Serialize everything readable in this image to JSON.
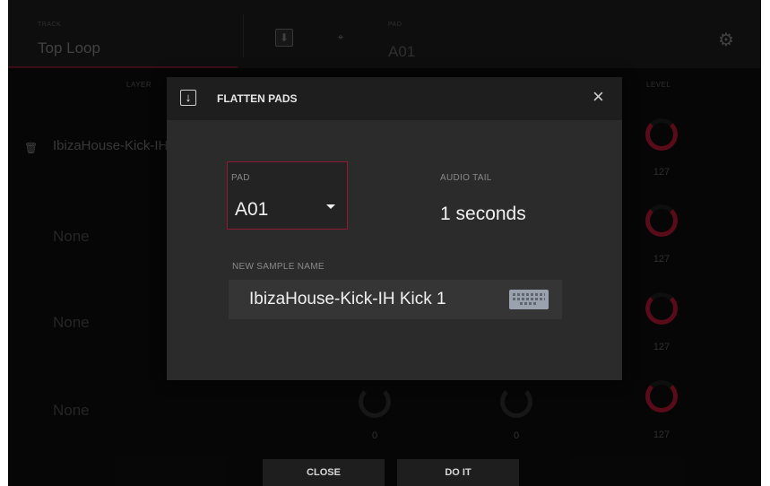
{
  "header": {
    "track_label": "TRACK",
    "track_name": "Top Loop",
    "pad_label": "PAD",
    "pad_name": "A01"
  },
  "columns": {
    "layer": "LAYER",
    "level": "LEVEL"
  },
  "layers": [
    {
      "name": "IbizaHouse-Kick-IH",
      "level": "127"
    },
    {
      "name": "None",
      "level": "127"
    },
    {
      "name": "None",
      "level": "127"
    },
    {
      "name": "None",
      "level": "127"
    }
  ],
  "row4_knobs": [
    "0",
    "0"
  ],
  "bottom_buttons": {
    "close": "CLOSE",
    "do_it": "DO IT"
  },
  "dialog": {
    "title": "FLATTEN PADS",
    "pad_label": "PAD",
    "pad_value": "A01",
    "audio_tail_label": "AUDIO TAIL",
    "audio_tail_value": "1 seconds",
    "sample_name_label": "NEW SAMPLE NAME",
    "sample_name_value": "IbizaHouse-Kick-IH Kick 1"
  },
  "icons": {
    "flatten": "download-arrow-icon",
    "close": "close-icon",
    "keyboard": "keyboard-icon",
    "settings": "gear-icon"
  },
  "colors": {
    "accent": "#a3142e",
    "background": "#0c0c0c",
    "dialog": "#2b2b2b"
  }
}
